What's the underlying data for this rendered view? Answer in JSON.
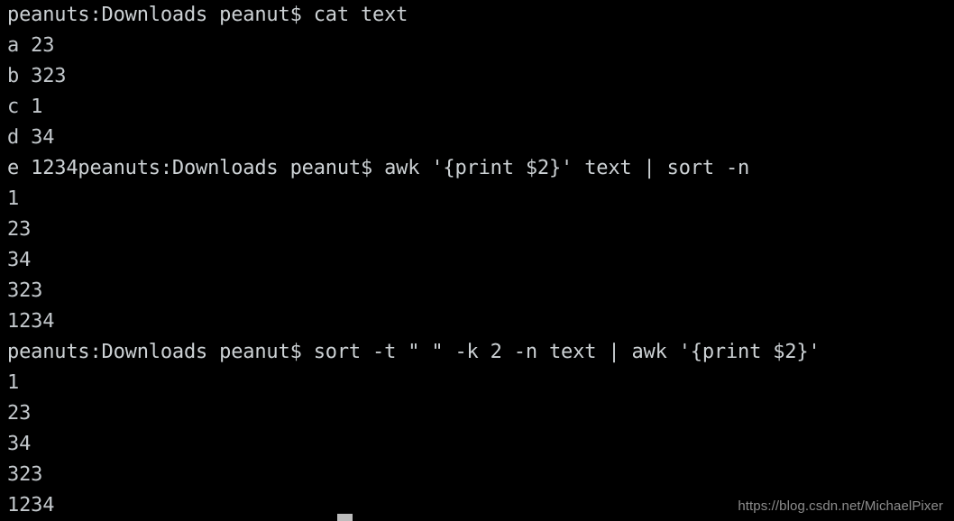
{
  "terminal": {
    "background_color": "#000000",
    "text_color": "#c8cdd0",
    "prompt": "peanuts:Downloads peanut$",
    "lines": [
      {
        "kind": "prompt",
        "text": "peanuts:Downloads peanut$ cat text"
      },
      {
        "kind": "output",
        "text": "a 23"
      },
      {
        "kind": "output",
        "text": "b 323"
      },
      {
        "kind": "output",
        "text": "c 1"
      },
      {
        "kind": "output",
        "text": "d 34"
      },
      {
        "kind": "prompt",
        "text": "e 1234peanuts:Downloads peanut$ awk '{print $2}' text | sort -n"
      },
      {
        "kind": "output",
        "text": "1"
      },
      {
        "kind": "output",
        "text": "23"
      },
      {
        "kind": "output",
        "text": "34"
      },
      {
        "kind": "output",
        "text": "323"
      },
      {
        "kind": "output",
        "text": "1234"
      },
      {
        "kind": "prompt",
        "text": "peanuts:Downloads peanut$ sort -t \" \" -k 2 -n text | awk '{print $2}'"
      },
      {
        "kind": "output",
        "text": "1"
      },
      {
        "kind": "output",
        "text": "23"
      },
      {
        "kind": "output",
        "text": "34"
      },
      {
        "kind": "output",
        "text": "323"
      },
      {
        "kind": "output",
        "text": "1234"
      }
    ],
    "commands": [
      "cat text",
      "awk '{print $2}' text | sort -n",
      "sort -t \" \" -k 2 -n text | awk '{print $2}'"
    ],
    "file_contents": {
      "name": "text",
      "rows": [
        {
          "key": "a",
          "value": "23"
        },
        {
          "key": "b",
          "value": "323"
        },
        {
          "key": "c",
          "value": "1"
        },
        {
          "key": "d",
          "value": "34"
        },
        {
          "key": "e",
          "value": "1234"
        }
      ]
    },
    "sorted_output": [
      "1",
      "23",
      "34",
      "323",
      "1234"
    ]
  },
  "watermark": {
    "text": "https://blog.csdn.net/MichaelPixer",
    "color": "#8d8d8d"
  },
  "cursor": {
    "color": "#bcbcbc"
  }
}
